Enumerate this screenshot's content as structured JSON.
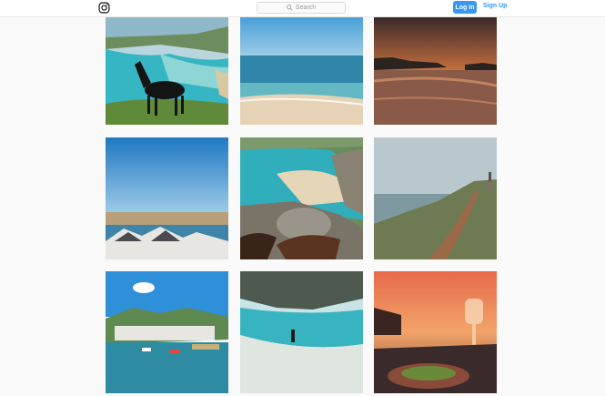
{
  "header": {
    "logo_icon": "instagram-icon",
    "search": {
      "placeholder": "Search",
      "icon": "search-icon"
    },
    "login_label": "Log In",
    "signup_label": "Sign Up"
  },
  "colors": {
    "accent": "#3897f0",
    "background": "#fafafa"
  },
  "posts": [
    {
      "subject": "black pony on clifftop above turquoise bay"
    },
    {
      "subject": "turquoise sea and sandy beach"
    },
    {
      "subject": "sunset over wet sand beach"
    },
    {
      "subject": "harbour town under blue sky"
    },
    {
      "subject": "two horses overlooking cove and rocks"
    },
    {
      "subject": "coastal path with engine house chimney"
    },
    {
      "subject": "harbour with boats and white cottages"
    },
    {
      "subject": "person wading in clear shallow water"
    },
    {
      "subject": "sunset dinner table with glass and salad"
    }
  ]
}
